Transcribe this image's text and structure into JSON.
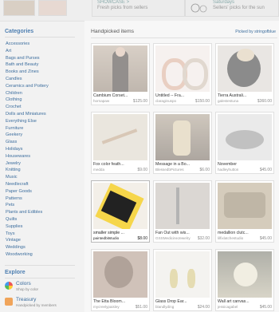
{
  "top": {
    "promo_left_title": "SHOWCASE >",
    "promo_left_sub": "Fresh picks from sellers",
    "promo_right_title": "Saturdays",
    "promo_right_sub": "Sellers' picks for the sun"
  },
  "sidebar": {
    "categories_title": "Categories",
    "categories": [
      "Accessories",
      "Art",
      "Bags and Purses",
      "Bath and Beauty",
      "Books and Zines",
      "Candles",
      "Ceramics and Pottery",
      "Children",
      "Clothing",
      "Crochet",
      "Dolls and Miniatures",
      "Everything Else",
      "Furniture",
      "Geekery",
      "Glass",
      "Holidays",
      "Housewares",
      "Jewelry",
      "Knitting",
      "Music",
      "Needlecraft",
      "Paper Goods",
      "Patterns",
      "Pets",
      "Plants and Edibles",
      "Quilts",
      "Supplies",
      "Toys",
      "Vintage",
      "Weddings",
      "Woodworking"
    ],
    "explore_title": "Explore",
    "explore": [
      {
        "name": "Colors",
        "sub": "Shop by color"
      },
      {
        "name": "Treasury",
        "sub": "Handpicked by members"
      }
    ]
  },
  "main": {
    "title": "Handpicked items",
    "picked_by": "Picked by stringofblue",
    "items": [
      {
        "title": "Cambium Corset...",
        "seller": "hornapaw",
        "price": "$125.00"
      },
      {
        "title": "Untitled -- Fra...",
        "seller": "claraginuspo",
        "price": "$150.00"
      },
      {
        "title": "Tierra Australi...",
        "seller": "galestestuna",
        "price": "$360.00"
      },
      {
        "title": "Fox color feath...",
        "seller": "medda",
        "price": "$9.00"
      },
      {
        "title": "Message in a Bo...",
        "seller": "BlessedbPictures",
        "price": "$6.00"
      },
      {
        "title": "November",
        "seller": "hadleyhutton",
        "price": "$45.00"
      },
      {
        "title": "smaller simple ...",
        "seller": "paintedbitstudio",
        "price": "$8.00"
      },
      {
        "title": "Fan Out with wis...",
        "seller": "GSSMedicineJewelry",
        "price": "$32.00"
      },
      {
        "title": "medallion clutc...",
        "seller": "lilfixlatchestudio",
        "price": "$45.00"
      },
      {
        "title": "The Etta Bloom...",
        "seller": "mycreelypaisley",
        "price": "$51.00"
      },
      {
        "title": "Glass Drop Ear...",
        "seller": "blandlyding",
        "price": "$24.00"
      },
      {
        "title": "Wall art canvas...",
        "seller": "jessicagabel",
        "price": "$45.00"
      }
    ]
  }
}
